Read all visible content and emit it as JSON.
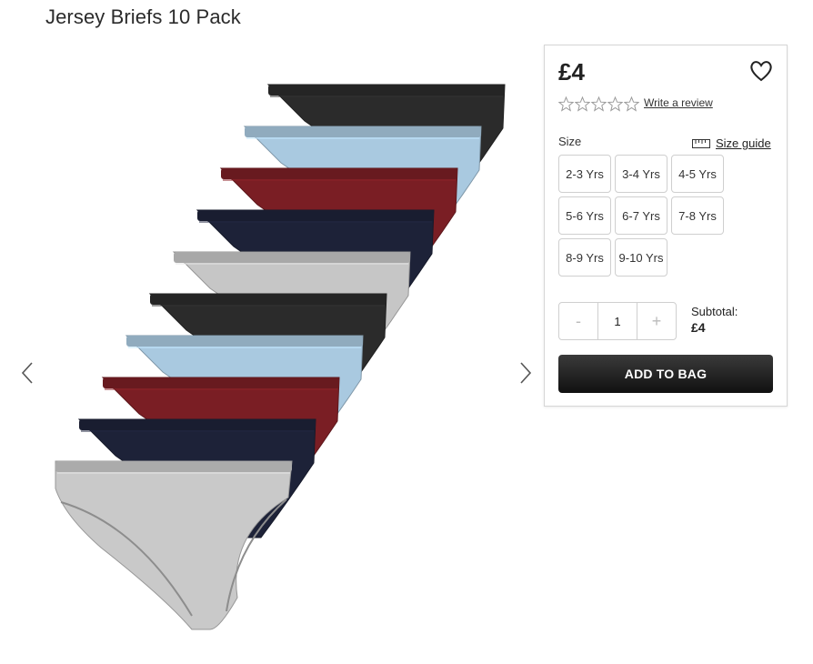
{
  "product": {
    "title": "Jersey Briefs 10 Pack",
    "price": "£4",
    "rating": {
      "stars": 5,
      "filled": 0,
      "review_link": "Write a review"
    }
  },
  "size": {
    "label": "Size",
    "guide_label": "Size guide",
    "options": [
      "2-3 Yrs",
      "3-4 Yrs",
      "4-5 Yrs",
      "5-6 Yrs",
      "6-7 Yrs",
      "7-8 Yrs",
      "8-9 Yrs",
      "9-10 Yrs"
    ]
  },
  "quantity": {
    "minus": "-",
    "value": "1",
    "plus": "+"
  },
  "subtotal": {
    "label": "Subtotal:",
    "value": "£4"
  },
  "actions": {
    "add_to_bag": "ADD TO BAG"
  },
  "gallery": {
    "prev_icon": "chevron-left-icon",
    "next_icon": "chevron-right-icon",
    "brief_colors": [
      "#2b2b2b",
      "#a9c9e0",
      "#7a1e24",
      "#1d2238",
      "#c6c6c6",
      "#2b2b2b",
      "#a9c9e0",
      "#7a1e24",
      "#1d2238",
      "#c9c9c9"
    ]
  }
}
